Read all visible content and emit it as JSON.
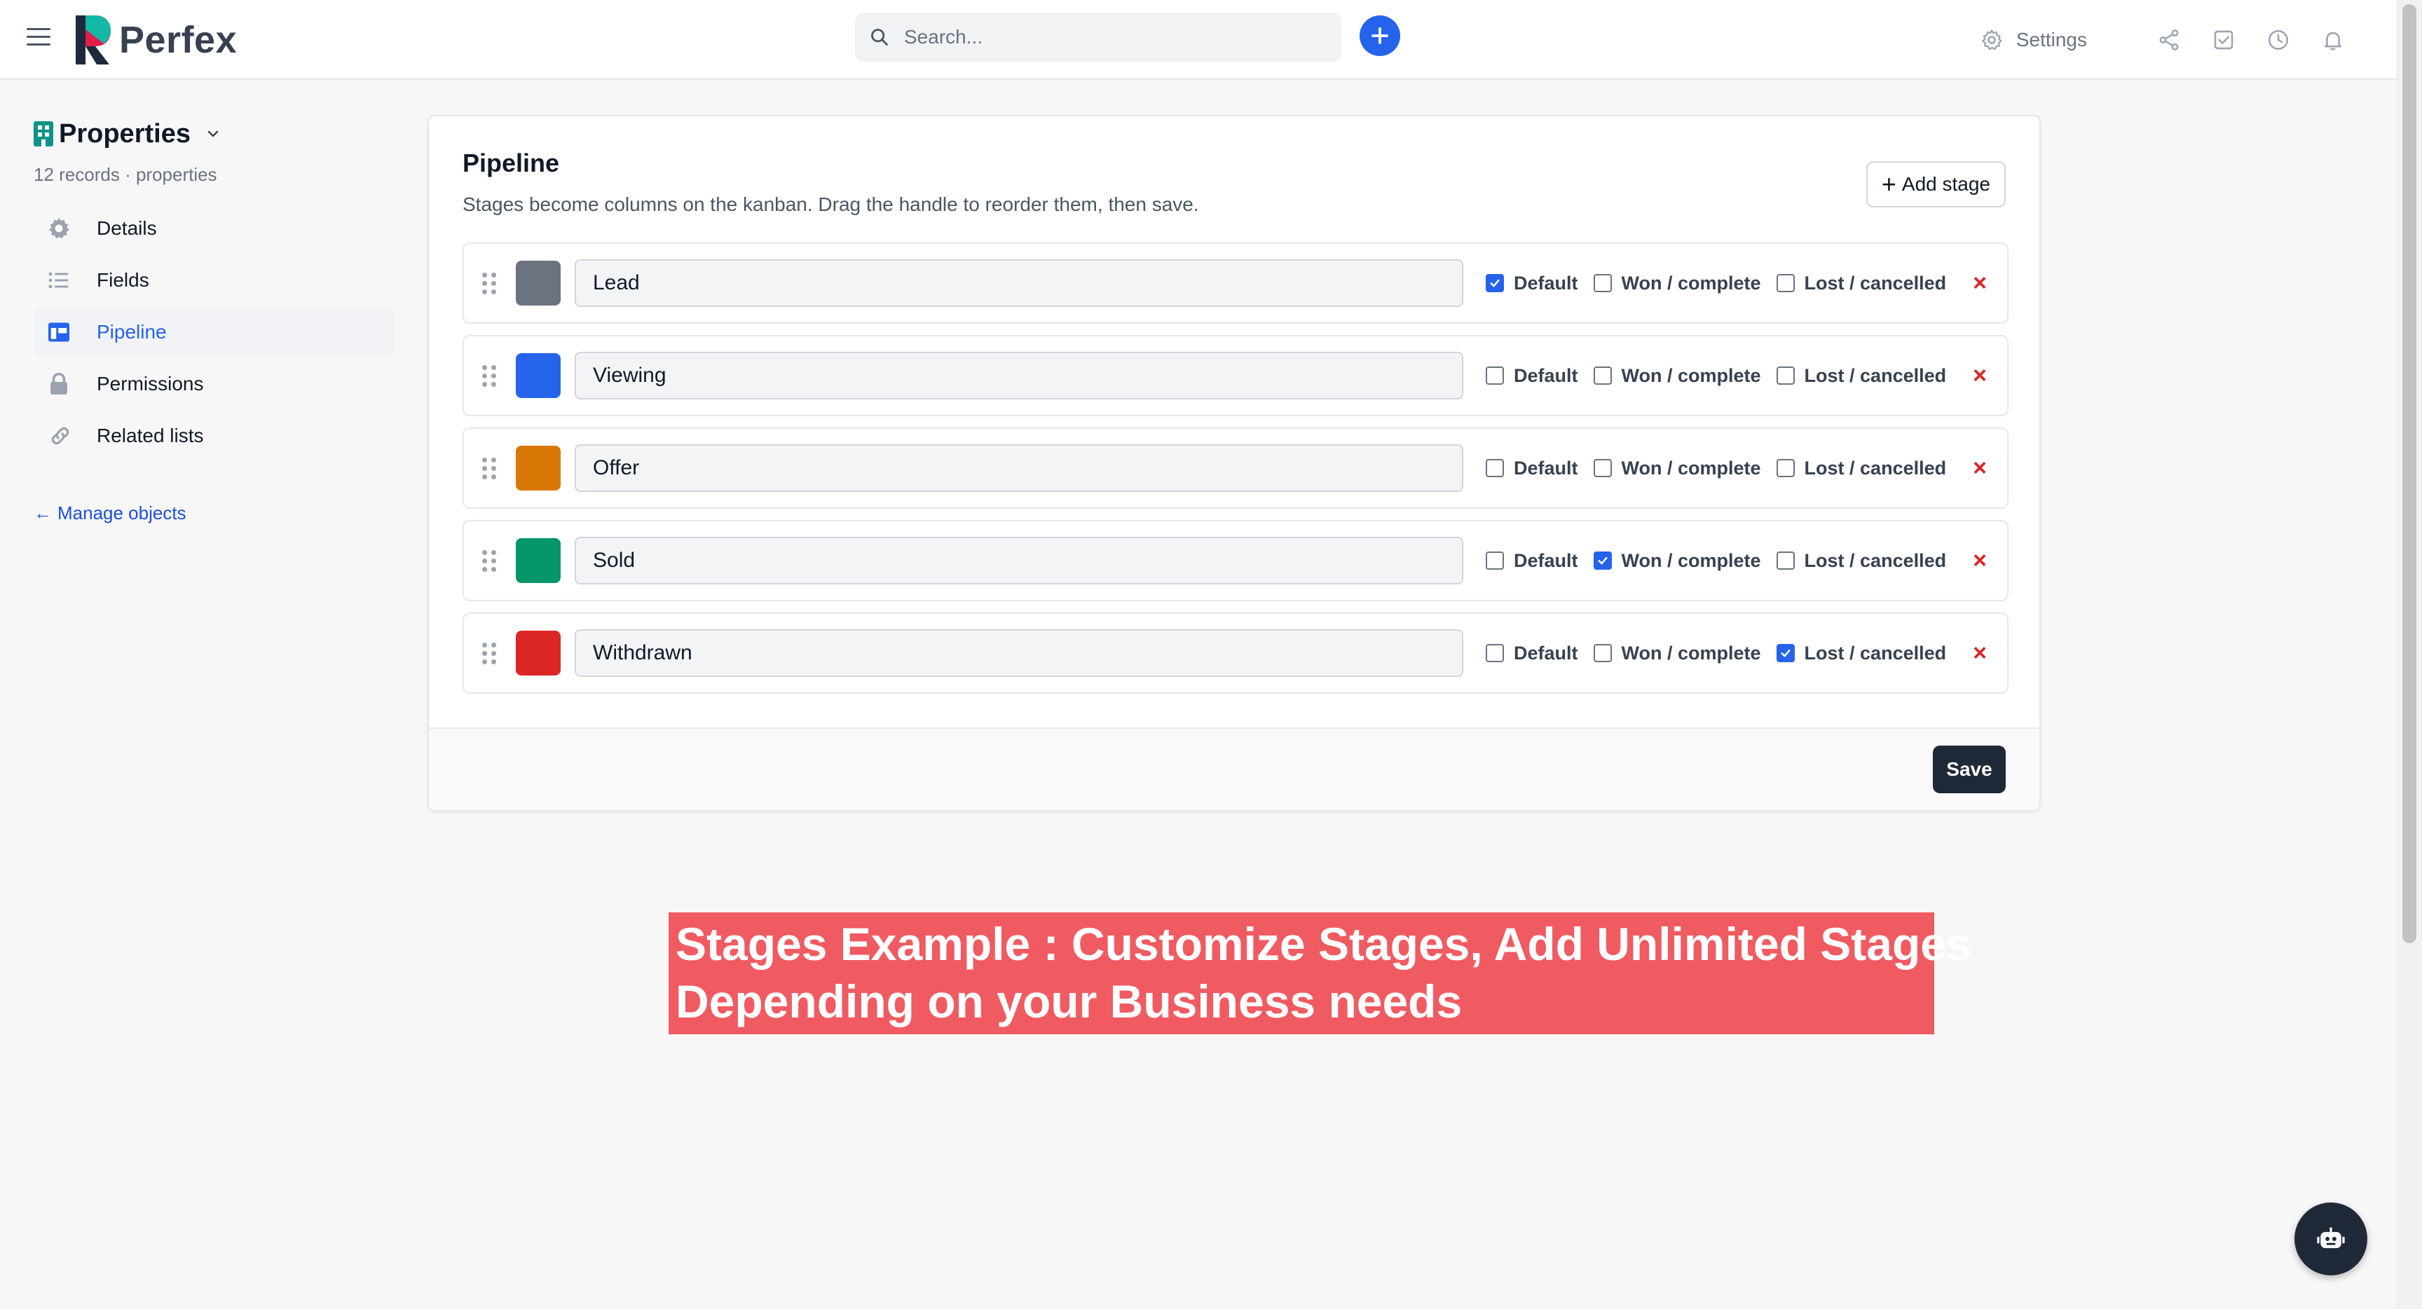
{
  "app": {
    "name": "Perfex"
  },
  "colors": {
    "accent": "#2563eb",
    "danger": "#dc2626",
    "banner": "#f05b62",
    "dark": "#1f2937"
  },
  "topbar": {
    "search_placeholder": "Search...",
    "settings_label": "Settings",
    "icons": [
      "menu-icon",
      "search-icon",
      "plus-icon",
      "gear-icon",
      "share-icon",
      "task-icon",
      "clock-icon",
      "bell-icon"
    ]
  },
  "sidebar": {
    "object_title": "Properties",
    "object_meta": "12 records · properties",
    "items": [
      {
        "label": "Details",
        "icon": "gear-icon",
        "active": false
      },
      {
        "label": "Fields",
        "icon": "list-icon",
        "active": false
      },
      {
        "label": "Pipeline",
        "icon": "columns-icon",
        "active": true
      },
      {
        "label": "Permissions",
        "icon": "lock-icon",
        "active": false
      },
      {
        "label": "Related lists",
        "icon": "link-icon",
        "active": false
      }
    ],
    "manage_link": "Manage objects"
  },
  "pipeline": {
    "title": "Pipeline",
    "subtitle": "Stages become columns on the kanban. Drag the handle to reorder them, then save.",
    "add_stage_label": "Add stage",
    "save_label": "Save",
    "option_labels": {
      "default": "Default",
      "won": "Won / complete",
      "lost": "Lost / cancelled"
    },
    "stages": [
      {
        "name": "Lead",
        "color": "#6b7280",
        "default": true,
        "won": false,
        "lost": false
      },
      {
        "name": "Viewing",
        "color": "#2563eb",
        "default": false,
        "won": false,
        "lost": false
      },
      {
        "name": "Offer",
        "color": "#d97706",
        "default": false,
        "won": false,
        "lost": false
      },
      {
        "name": "Sold",
        "color": "#059669",
        "default": false,
        "won": true,
        "lost": false
      },
      {
        "name": "Withdrawn",
        "color": "#dc2626",
        "default": false,
        "won": false,
        "lost": true
      }
    ]
  },
  "banner": {
    "line1": "Stages Example : Customize Stages, Add Unlimited Stages",
    "line2": "Depending on your Business needs"
  }
}
